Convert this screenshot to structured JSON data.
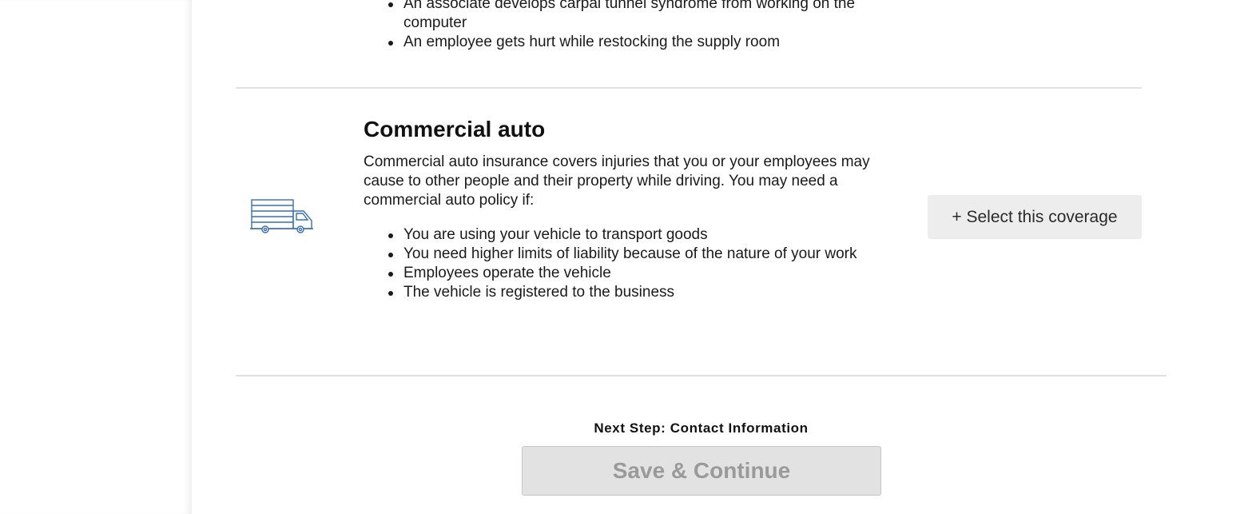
{
  "previous_coverage": {
    "icon": "coverage-icon",
    "bullets": [
      "An associate develops carpal tunnel syndrome from working on the computer",
      "An employee gets hurt while restocking the supply room"
    ]
  },
  "commercial_auto": {
    "icon": "truck-icon",
    "title": "Commercial auto",
    "description": "Commercial auto insurance covers injuries that you or your employees may cause to other people and their property while driving. You may need a commercial auto policy if:",
    "bullets": [
      "You are using your vehicle to transport goods",
      "You need higher limits of liability because of the nature of your work",
      "Employees operate the vehicle",
      "The vehicle is registered to the business"
    ],
    "select_label": "+ Select this coverage"
  },
  "footer": {
    "next_step": "Next Step: Contact Information",
    "save_label": "Save & Continue",
    "save_disabled": true
  },
  "colors": {
    "icon_blue": "#3a6fb0",
    "divider": "#e2e2e2",
    "select_button_bg": "#ededed",
    "disabled_button_bg": "#e2e2e2",
    "disabled_text": "#9a9a9a"
  }
}
